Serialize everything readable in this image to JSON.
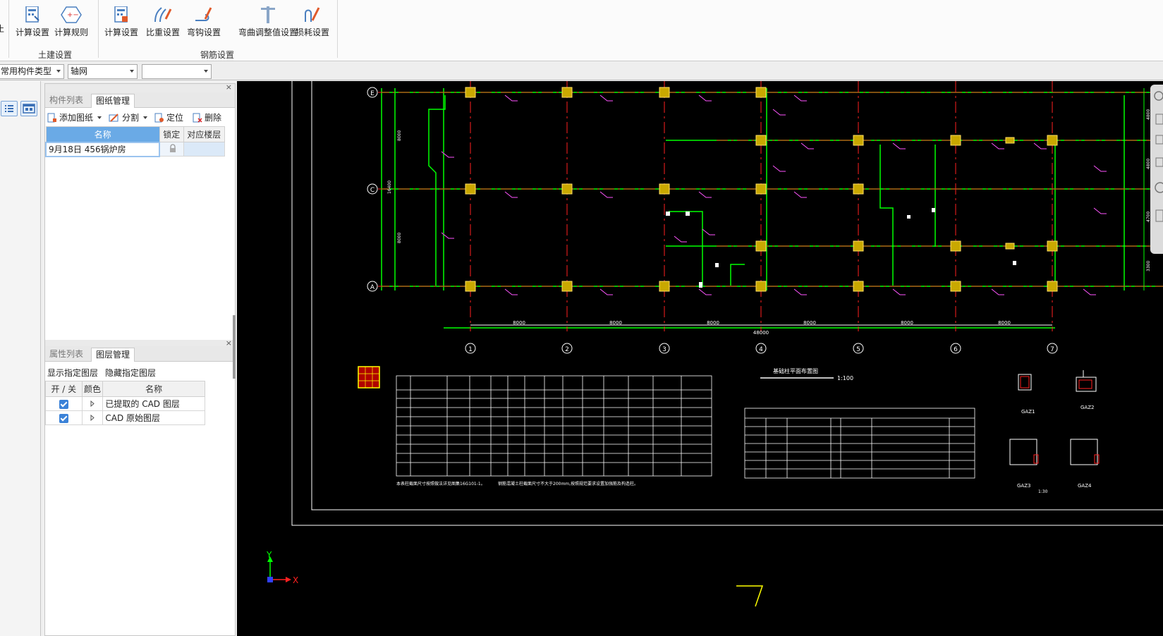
{
  "ribbon": {
    "groups": [
      {
        "label": "土建设置",
        "buttons": [
          "计算设置",
          "计算规则"
        ]
      },
      {
        "label": "钢筋设置",
        "buttons": [
          "计算设置",
          "比重设置",
          "弯钩设置",
          "弯曲调整值设置",
          "损耗设置"
        ]
      }
    ],
    "partial_left_glyph": "止"
  },
  "toolbar": {
    "component_type": "常用构件类型",
    "component": "轴网",
    "sub_component": ""
  },
  "drawing_panel": {
    "tabs": [
      "构件列表",
      "图纸管理"
    ],
    "active_tab": 1,
    "tools": [
      "添加图纸",
      "分割",
      "定位",
      "删除"
    ],
    "columns": [
      "名称",
      "锁定",
      "对应楼层"
    ],
    "rows": [
      {
        "name": "9月18日 456锅炉房",
        "locked": true,
        "floor": ""
      }
    ],
    "close_glyph": "×"
  },
  "layer_panel": {
    "tabs": [
      "属性列表",
      "图层管理"
    ],
    "active_tab": 1,
    "actions": [
      "显示指定图层",
      "隐藏指定图层"
    ],
    "columns": [
      "开 / 关",
      "颜色",
      "名称"
    ],
    "rows": [
      {
        "name": "已提取的 CAD 图层",
        "on": true
      },
      {
        "name": "CAD 原始图层",
        "on": true
      }
    ],
    "close_glyph": "×"
  },
  "cad": {
    "row_axes": [
      "E",
      "C",
      "A"
    ],
    "col_axes": [
      "1",
      "2",
      "3",
      "4",
      "5",
      "6",
      "7"
    ],
    "span_dims": [
      "8000",
      "8000",
      "8000",
      "8000",
      "8000",
      "8000"
    ],
    "total_dim": "48000",
    "left_dims": [
      "8000",
      "16400",
      "8000"
    ],
    "right_dims": [
      "4800",
      "4800",
      "4700",
      "3300"
    ],
    "plan_title": "基础柱平面布置图",
    "plan_scale": "1:100",
    "detail_labels": [
      "GAZ1",
      "GAZ2",
      "GAZ3",
      "GAZ4"
    ],
    "detail_scale": "1:30",
    "note_left": "本表柱截面尺寸按照做法详见图集16G101-1。",
    "note_mid": "钢筋混凝土柱截面尺寸不大于200mm,按照规范要求设置加强筋及构造柱。",
    "axis_x": "X",
    "axis_y": "Y",
    "colors": {
      "grid": "#00ff00",
      "axis": "#ff2020",
      "column": "#d4b000",
      "tag": "#ff55ff",
      "text": "#ffffff",
      "label": "#ffff00"
    }
  }
}
